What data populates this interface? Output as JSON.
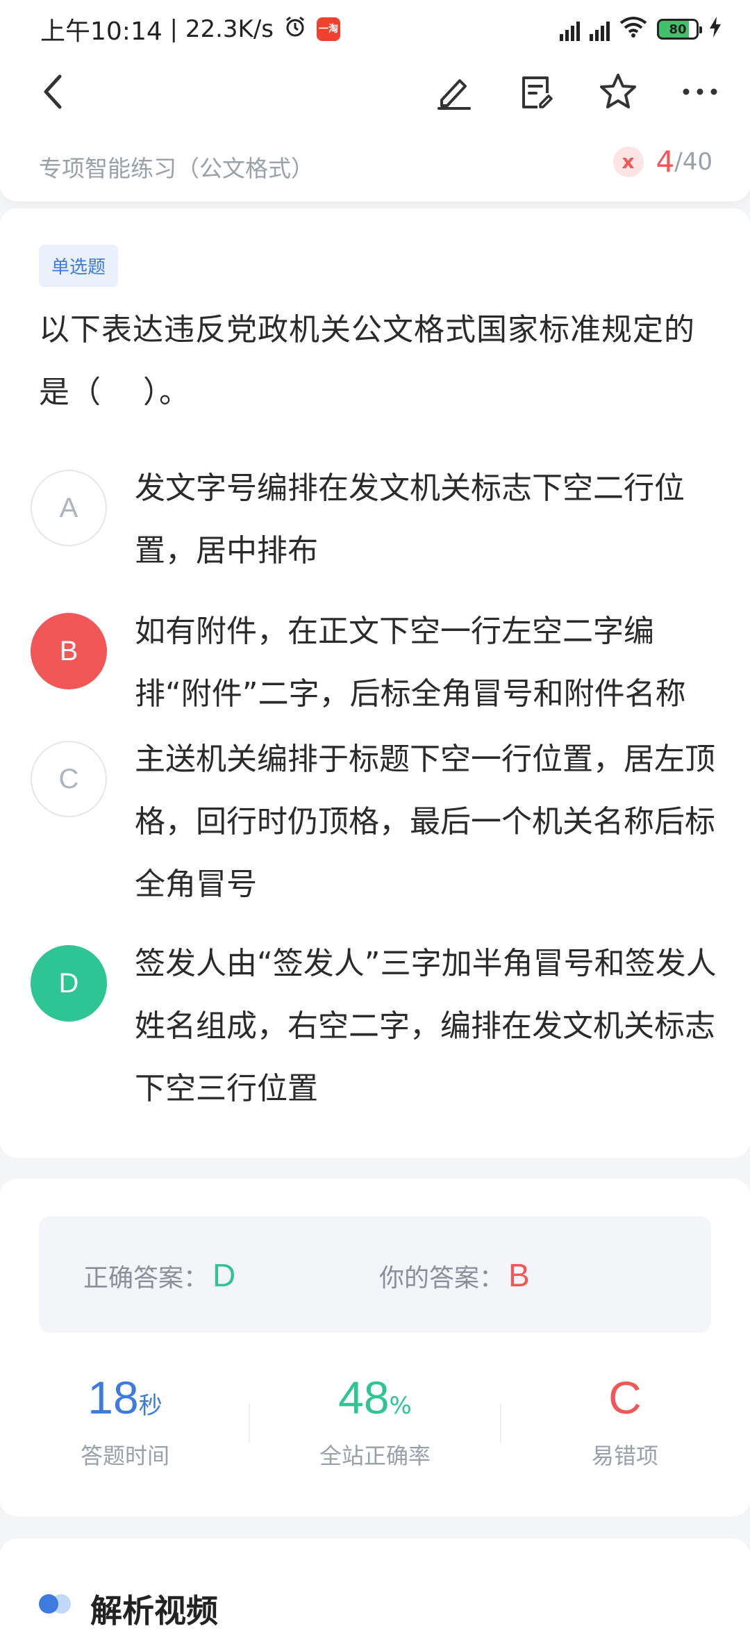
{
  "status_bar": {
    "time": "上午10:14",
    "speed": "22.3K/s",
    "app_badge": "一淘",
    "signal_label": "HD",
    "battery": "80"
  },
  "nav": {
    "back_icon": "chevron-left-icon",
    "edit_icon": "pencil-icon",
    "notes_icon": "note-icon",
    "favorite_icon": "star-icon",
    "more_icon": "more-dots-icon"
  },
  "practice": {
    "title": "专项智能练习（公文格式）",
    "status_icon": "x",
    "current": "4",
    "separator": "/",
    "total": "40"
  },
  "question": {
    "type": "单选题",
    "stem": "以下表达违反党政机关公文格式国家标准规定的是（　 ）。",
    "options": [
      {
        "letter": "A",
        "text": "发文字号编排在发文机关标志下空二行位置，居中排布",
        "state": "normal"
      },
      {
        "letter": "B",
        "text": "如有附件，在正文下空一行左空二字编排“附件”二字，后标全角冒号和附件名称",
        "state": "wrong"
      },
      {
        "letter": "C",
        "text": "主送机关编排于标题下空一行位置，居左顶格，回行时仍顶格，最后一个机关名称后标全角冒号",
        "state": "normal"
      },
      {
        "letter": "D",
        "text": "签发人由“签发人”三字加半角冒号和签发人姓名组成，右空二字，编排在发文机关标志下空三行位置",
        "state": "correct"
      }
    ]
  },
  "answer": {
    "correct_label": "正确答案：",
    "correct_value": "D",
    "yours_label": "你的答案：",
    "yours_value": "B"
  },
  "stats": {
    "time_value": "18",
    "time_unit": "秒",
    "time_label": "答题时间",
    "rate_value": "48",
    "rate_unit": "%",
    "rate_label": "全站正确率",
    "error_value": "C",
    "error_label": "易错项"
  },
  "video": {
    "title": "解析视频"
  },
  "colors": {
    "accent_blue": "#3d7be0",
    "correct_green": "#2ec494",
    "wrong_red": "#f25757"
  }
}
